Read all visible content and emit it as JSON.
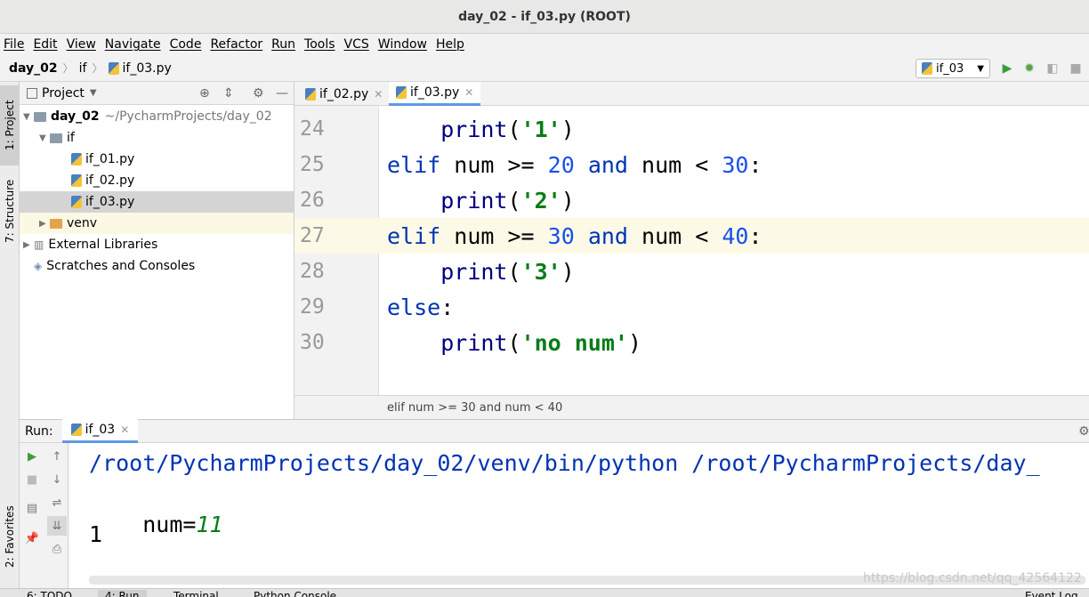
{
  "window": {
    "title": "day_02 - if_03.py (ROOT)"
  },
  "menu": [
    "File",
    "Edit",
    "View",
    "Navigate",
    "Code",
    "Refactor",
    "Run",
    "Tools",
    "VCS",
    "Window",
    "Help"
  ],
  "breadcrumb": {
    "project": "day_02",
    "folder": "if",
    "file": "if_03.py"
  },
  "run_config": {
    "name": "if_03"
  },
  "side_tabs": {
    "project": "1: Project",
    "structure": "7: Structure",
    "favorites": "2: Favorites"
  },
  "project_panel": {
    "title": "Project",
    "root_name": "day_02",
    "root_path": "~/PycharmProjects/day_02",
    "folder_if": "if",
    "files": [
      "if_01.py",
      "if_02.py",
      "if_03.py"
    ],
    "venv": "venv",
    "external": "External Libraries",
    "scratches": "Scratches and Consoles"
  },
  "editor_tabs": [
    "if_02.py",
    "if_03.py"
  ],
  "code_lines": [
    {
      "ln": "24",
      "indent": "    ",
      "parts": [
        [
          "fn",
          "print"
        ],
        [
          "p",
          "("
        ],
        [
          "str",
          "'1'"
        ],
        [
          "p",
          ")"
        ]
      ]
    },
    {
      "ln": "25",
      "indent": "",
      "parts": [
        [
          "kw",
          "elif"
        ],
        [
          "p",
          " num >= "
        ],
        [
          "num",
          "20"
        ],
        [
          "p",
          " "
        ],
        [
          "kw",
          "and"
        ],
        [
          "p",
          " num < "
        ],
        [
          "num",
          "30"
        ],
        [
          "p",
          ":"
        ]
      ]
    },
    {
      "ln": "26",
      "indent": "    ",
      "parts": [
        [
          "fn",
          "print"
        ],
        [
          "p",
          "("
        ],
        [
          "str",
          "'2'"
        ],
        [
          "p",
          ")"
        ]
      ]
    },
    {
      "ln": "27",
      "indent": "",
      "parts": [
        [
          "kw",
          "elif"
        ],
        [
          "p",
          " num >= "
        ],
        [
          "num",
          "30"
        ],
        [
          "p",
          " "
        ],
        [
          "kw",
          "and"
        ],
        [
          "p",
          " num < "
        ],
        [
          "num",
          "40"
        ],
        [
          "p",
          ":"
        ]
      ]
    },
    {
      "ln": "28",
      "indent": "    ",
      "parts": [
        [
          "fn",
          "print"
        ],
        [
          "p",
          "("
        ],
        [
          "str",
          "'3'"
        ],
        [
          "p",
          ")"
        ]
      ]
    },
    {
      "ln": "29",
      "indent": "",
      "parts": [
        [
          "kw",
          "else"
        ],
        [
          "p",
          ":"
        ]
      ]
    },
    {
      "ln": "30",
      "indent": "    ",
      "parts": [
        [
          "fn",
          "print"
        ],
        [
          "p",
          "("
        ],
        [
          "str",
          "'no num'"
        ],
        [
          "p",
          ")"
        ]
      ]
    }
  ],
  "current_line": "27",
  "status_breadcrumb": "elif num >= 30 and num < 40",
  "run_panel": {
    "label": "Run:",
    "tab": "if_03"
  },
  "console": {
    "line1": "/root/PycharmProjects/day_02/venv/bin/python /root/PycharmProjects/day_",
    "line2_label": "num=",
    "line2_value": "11",
    "line3": "1"
  },
  "bottom_tabs": [
    "6: TODO",
    "4: Run",
    "Terminal",
    "Python Console"
  ],
  "event_log": "Event Log",
  "watermark": "https://blog.csdn.net/qq_42564122",
  "colors": {
    "keyword": "#0033b3",
    "number": "#1750eb",
    "string": "#067d17",
    "current_line": "#fcfae6",
    "tab_accent": "#5c9ae6"
  }
}
